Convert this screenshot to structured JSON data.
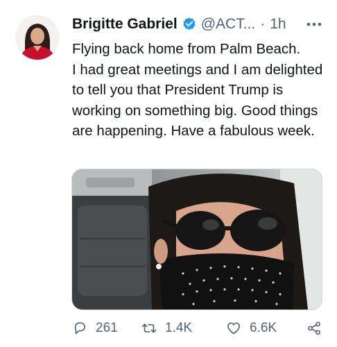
{
  "tweet": {
    "author_name": "Brigitte Gabriel",
    "handle": "@ACT...",
    "separator": "·",
    "time": "1h",
    "text": "Flying back home from Palm Beach.\nI had great meetings and I am delighted to tell you that President Trump is working on something big. Good things are happening. Have a fabulous week."
  },
  "actions": {
    "replies": "261",
    "retweets": "1.4K",
    "likes": "6.6K"
  },
  "icons": {
    "verified": "verified-badge-icon",
    "more": "more-dots-icon",
    "reply": "reply-icon",
    "retweet": "retweet-icon",
    "like": "heart-icon",
    "share": "share-icon"
  },
  "colors": {
    "text": "#0f1419",
    "secondary": "#536471",
    "verified": "#1d9bf0"
  }
}
